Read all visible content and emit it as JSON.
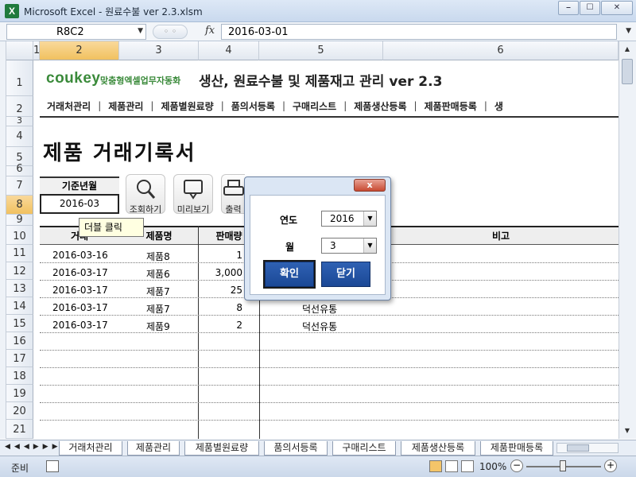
{
  "window": {
    "app_icon": "X",
    "title": "Microsoft Excel - 원료수불 ver 2.3.xlsm",
    "min": "⎯",
    "max": "☐",
    "close": "✕"
  },
  "formula_bar": {
    "name_box": "R8C2",
    "fx": "fx",
    "value": "2016-03-01"
  },
  "columns": [
    "1",
    "2",
    "3",
    "4",
    "5",
    "6"
  ],
  "rows": [
    "1",
    "2",
    "3",
    "4",
    "5",
    "6",
    "7",
    "8",
    "9",
    "10",
    "11",
    "12",
    "13",
    "14",
    "15",
    "16",
    "17",
    "18",
    "19",
    "20",
    "21"
  ],
  "logo": {
    "brand": "coukey",
    "tagline": "맞춤형엑셀업무자동화"
  },
  "app_title": "생산, 원료수불 및 제품재고 관리 ver 2.3",
  "menu": [
    "거래처관리",
    "제품관리",
    "제품별원료량",
    "품의서등록",
    "구매리스트",
    "제품생산등록",
    "제품판매등록",
    "생"
  ],
  "page_title": "제품 거래기록서",
  "base_month": {
    "label": "기준년월",
    "value": "2016-03"
  },
  "buttons": {
    "search": "조회하기",
    "preview": "미리보기",
    "print": "출력하"
  },
  "tooltip": "더블 클릭",
  "table": {
    "headers": [
      "거래",
      "제품명",
      "판매량",
      "비고"
    ],
    "rows": [
      {
        "date": "2016-03-16",
        "product": "제품8",
        "qty": "1",
        "client": ""
      },
      {
        "date": "2016-03-17",
        "product": "제품6",
        "qty": "3,000",
        "client": ""
      },
      {
        "date": "2016-03-17",
        "product": "제품7",
        "qty": "25",
        "client": ""
      },
      {
        "date": "2016-03-17",
        "product": "제품7",
        "qty": "8",
        "client": "덕선유통"
      },
      {
        "date": "2016-03-17",
        "product": "제품9",
        "qty": "2",
        "client": "덕선유통"
      }
    ]
  },
  "dialog": {
    "close": "x",
    "year_label": "연도",
    "year_value": "2016",
    "month_label": "월",
    "month_value": "3",
    "ok": "확인",
    "cancel": "닫기"
  },
  "sheet_tabs": [
    "거래처관리",
    "제품관리",
    "제품별원료량",
    "품의서등록",
    "구매리스트",
    "제품생산등록",
    "제품판매등록"
  ],
  "status": {
    "ready": "준비",
    "zoom": "100%"
  }
}
